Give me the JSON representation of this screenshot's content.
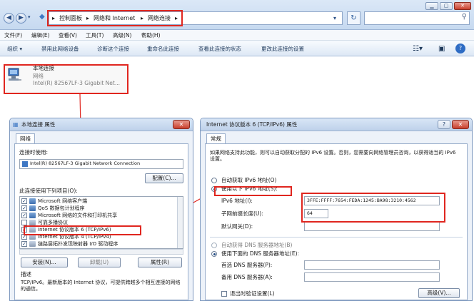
{
  "explorer": {
    "breadcrumb": [
      "控制面板",
      "网络和 Internet",
      "网络连接"
    ],
    "breadcrumb_sep": "▸",
    "menu": [
      "文件(F)",
      "编辑(E)",
      "查看(V)",
      "工具(T)",
      "高级(N)",
      "帮助(H)"
    ],
    "commands": [
      "组织 ▾",
      "禁用此网络设备",
      "诊断这个连接",
      "重命名此连接",
      "查看此连接的状态",
      "更改此连接的设置"
    ],
    "adapter": {
      "name": "本地连接",
      "network": "网络",
      "device": "Intel(R) 82567LF-3 Gigabit Net..."
    }
  },
  "props_dialog": {
    "title": "本地连接 属性",
    "tab": "网络",
    "connect_using_label": "连接时使用:",
    "adapter": "Intel(R) 82567LF-3 Gigabit Network Connection",
    "configure_button": "配置(C)...",
    "items_label": "此连接使用下列项目(O):",
    "items": [
      {
        "label": "Microsoft 网络客户端",
        "checked": true
      },
      {
        "label": "QoS 数据包计划程序",
        "checked": true
      },
      {
        "label": "Microsoft 网络的文件和打印机共享",
        "checked": true
      },
      {
        "label": "可靠多播协议",
        "checked": false
      },
      {
        "label": "Internet 协议版本 6 (TCP/IPv6)",
        "checked": true
      },
      {
        "label": "Internet 协议版本 4 (TCP/IPv4)",
        "checked": true
      },
      {
        "label": "链路层拓扑发现映射器 I/O 驱动程序",
        "checked": true
      }
    ],
    "install_button": "安装(N)...",
    "uninstall_button": "卸载(U)",
    "properties_button": "属性(R)",
    "description_label": "描述",
    "description_text": "TCP/IPv6。最新版本的 Internet 协议，可提供跨越多个相互连接的网络的通信。"
  },
  "ipv6_dialog": {
    "title": "Internet 协议版本 6 (TCP/IPv6) 属性",
    "tab": "常规",
    "intro": "如果网络支持此功能，则可以自动获取分配的 IPv6 设置。否则，您需要向网络管理员咨询，以获得适当的 IPv6 设置。",
    "auto_ip": "自动获取 IPv6 地址(O)",
    "manual_ip": "使用以下 IPv6 地址(S):",
    "address_label": "IPv6 地址(I):",
    "address_value": "3FFE:FFFF:7654:FEDA:1245:BA98:3210:4562",
    "prefix_label": "子网前缀长度(U):",
    "prefix_value": "64",
    "gateway_label": "默认网关(D):",
    "gateway_value": "",
    "auto_dns": "自动获得 DNS 服务器地址(B)",
    "manual_dns": "使用下面的 DNS 服务器地址(E):",
    "dns1_label": "首选 DNS 服务器(P):",
    "dns2_label": "备用 DNS 服务器(A):",
    "validate_label": "退出时验证设置(L)",
    "advanced_button": "高级(V)..."
  },
  "colors": {
    "highlight": "#e0261f",
    "selection": "#3a6ea5"
  }
}
